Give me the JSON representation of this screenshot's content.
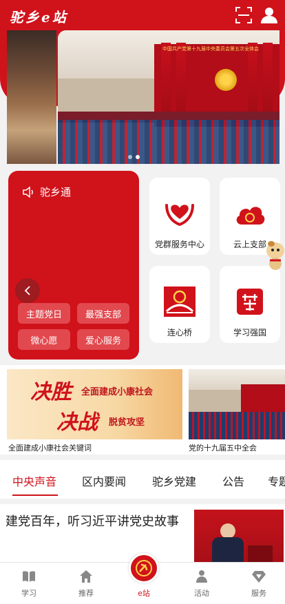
{
  "header": {
    "logo_text": "驼乡e站",
    "scan_icon": "scan-icon",
    "user_icon": "user-icon"
  },
  "banner": {
    "hall_title": "中国共产党第十九届中央委员会第五次全体会",
    "active_index": 1,
    "dot_count": 2
  },
  "card": {
    "title": "驼乡通",
    "title_icon": "speaker-icon",
    "buttons": [
      "主题党日",
      "最强支部",
      "微心愿",
      "爱心服务"
    ]
  },
  "tiles": [
    {
      "label": "党群服务中心",
      "icon": "hands-heart-icon"
    },
    {
      "label": "云上支部",
      "icon": "cloud-party-icon"
    },
    {
      "label": "连心桥",
      "icon": "bridge-icon"
    },
    {
      "label": "学习强国",
      "icon": "study-icon"
    }
  ],
  "news": {
    "banner_big1": "决胜",
    "banner_sub1": "全面建成小康社会",
    "banner_big2": "决战",
    "banner_sub2": "脱贫攻坚",
    "caption1": "全面建成小康社会关键词",
    "caption2": "党的十九届五中全会"
  },
  "tabs": [
    "中央声音",
    "区内要闻",
    "驼乡党建",
    "公告",
    "专题"
  ],
  "article": {
    "title": "建党百年，听习近平讲党史故事"
  },
  "bottom_nav": {
    "items": [
      "学习",
      "推荐",
      "e站",
      "活动",
      "服务"
    ],
    "active": "e站"
  },
  "colors": {
    "brand_red": "#d0121b"
  }
}
